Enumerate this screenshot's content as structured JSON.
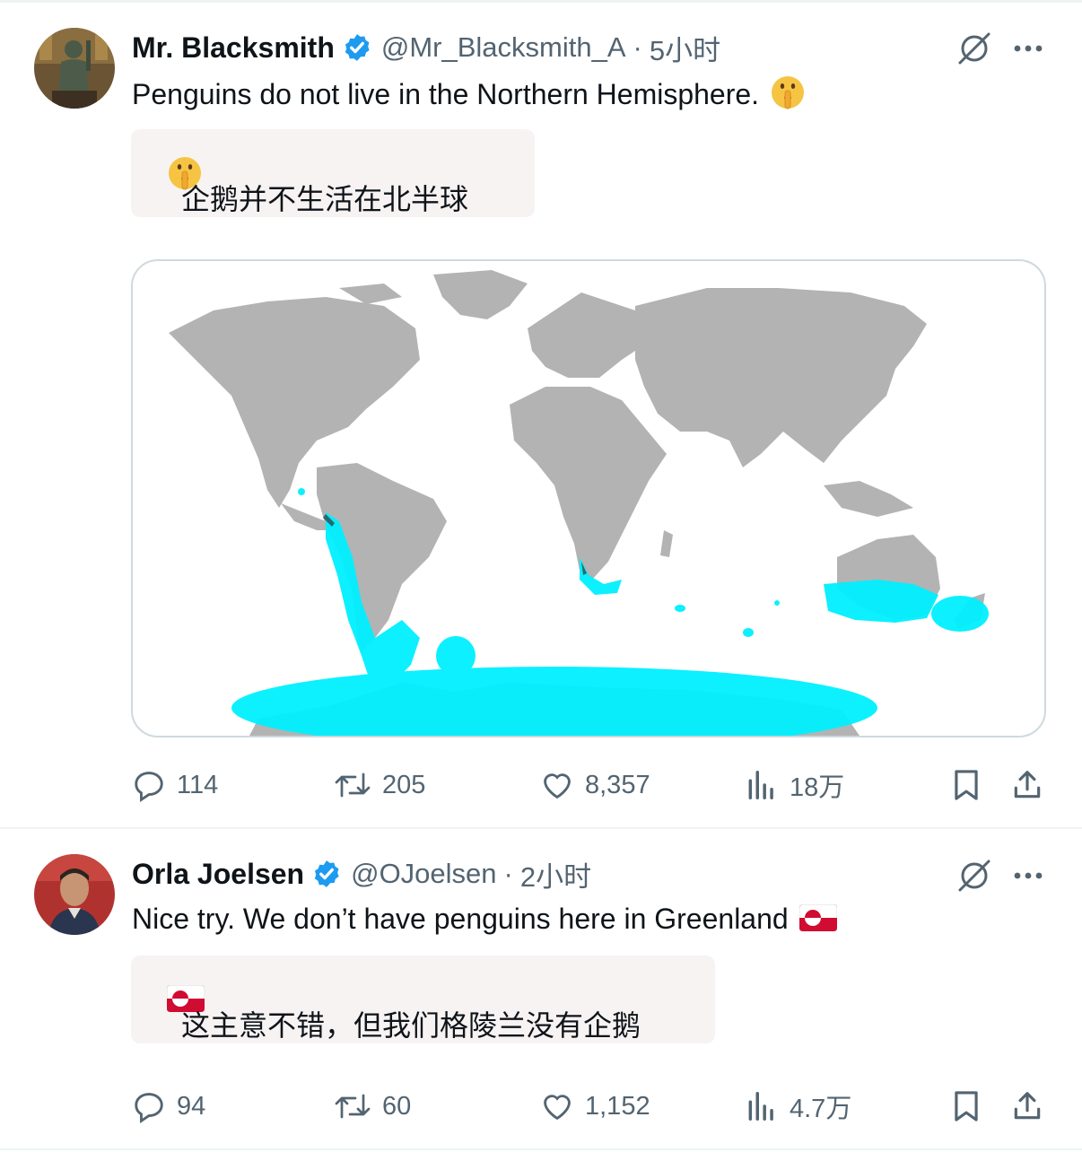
{
  "tweets": [
    {
      "author_name": "Mr. Blacksmith",
      "handle": "@Mr_Blacksmith_A",
      "separator": "·",
      "time": "5小时",
      "text": "Penguins do not live in the Northern Hemisphere.",
      "text_emoji": "shushing-face-emoji",
      "translation": "企鹅并不生活在北半球",
      "media": "world-map-penguin-distribution",
      "stats": {
        "replies": "114",
        "reposts": "205",
        "likes": "8,357",
        "views": "18万"
      }
    },
    {
      "author_name": "Orla Joelsen",
      "handle": "@OJoelsen",
      "separator": "·",
      "time": "2小时",
      "text": "Nice try. We don’t have penguins here in Greenland",
      "text_emoji": "greenland-flag-emoji",
      "translation": "这主意不错，但我们格陵兰没有企鹅",
      "stats": {
        "replies": "94",
        "reposts": "60",
        "likes": "1,152",
        "views": "4.7万"
      }
    }
  ],
  "colors": {
    "verified": "#1d9bf0",
    "text": "#0f1419",
    "secondary": "#536471",
    "land": "#b3b3b3",
    "penguin_range": "#00f0ff",
    "translation_bg": "#f7f3f3"
  }
}
